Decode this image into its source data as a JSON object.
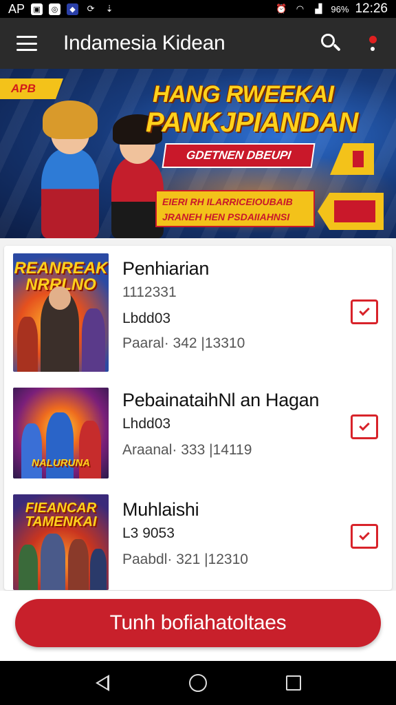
{
  "status_bar": {
    "carrier": "AP",
    "battery": "96%",
    "time": "12:26",
    "icons": [
      "app-notification-icon",
      "circle-notification-icon",
      "shield-notification-icon",
      "sync-icon",
      "download-icon",
      "alarm-icon",
      "wifi-icon",
      "signal-icon"
    ]
  },
  "app_bar": {
    "title": "Indamesia Kidean"
  },
  "banner": {
    "tag": "APB",
    "headline_1": "HANG RWEEKAI",
    "headline_2": "PANKJPIANDAN",
    "ribbon": "GDETNEN DBEUPI",
    "sub_line_1": "EIERI RH ILARRICEIOUBAIB",
    "sub_line_2": "JRANEH HEN PSDAIIAHNSI",
    "colors": {
      "accent_yellow": "#ffd21c",
      "accent_red": "#c9182a",
      "bg_blue": "#173a7a"
    }
  },
  "items": [
    {
      "thumb_title": "REANREAK NRRLNO",
      "title": "Penhiarian",
      "line_1": "1112331",
      "line_2": "Lbdd03",
      "line_3": "Paaral· 342 |13310"
    },
    {
      "thumb_title": "NALURUNA",
      "title": "PebainataihNl an Hagan",
      "line_1": "Lhdd03",
      "line_2": "Araanal· 333 |14119"
    },
    {
      "thumb_title": "FIEANCAR TAMENKAI",
      "title": "Muhlaishi",
      "line_1": "L3 9053",
      "line_2": "Paabdl· 321 |12310"
    }
  ],
  "cta": {
    "label": "Tunh bofiahatoltaes",
    "color": "#c8202b"
  }
}
